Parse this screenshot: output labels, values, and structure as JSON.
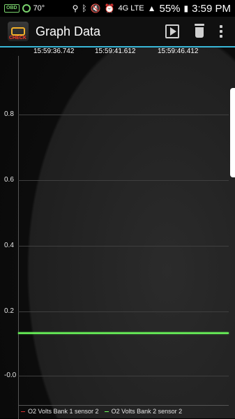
{
  "status_bar": {
    "left": {
      "obd_icon_label": "OBD",
      "temperature": "70°"
    },
    "right": {
      "battery": "55%",
      "time": "3:59 PM",
      "network": "4G LTE"
    }
  },
  "app_bar": {
    "title": "Graph Data",
    "logo_text": "CHECK",
    "actions": [
      "play-icon",
      "trash-icon",
      "kebab-menu-icon"
    ],
    "accent_line_color": "#38b6d7"
  },
  "graph": {
    "timestamps": [
      "15:59:36.742",
      "15:59:41.612",
      "15:59:46.412"
    ],
    "y_ticks": [
      "0.8",
      "0.6",
      "0.4",
      "0.2",
      "-0.0"
    ],
    "legend": [
      {
        "label": "O2 Volts Bank 1 sensor 2",
        "color": "#d33"
      },
      {
        "label": "O2 Volts Bank 2 sensor 2",
        "color": "#6cff5c"
      }
    ]
  },
  "chart_data": {
    "type": "line",
    "title": "",
    "xlabel": "",
    "ylabel": "",
    "x": [
      "15:59:36.742",
      "15:59:41.612",
      "15:59:46.412"
    ],
    "ylim": [
      -0.0,
      0.8
    ],
    "series": [
      {
        "name": "O2 Volts Bank 1 sensor 2",
        "values": []
      },
      {
        "name": "O2 Volts Bank 2 sensor 2",
        "values": [
          0.135,
          0.135,
          0.135
        ]
      }
    ],
    "grid": true,
    "legend_placement": "bottom"
  }
}
